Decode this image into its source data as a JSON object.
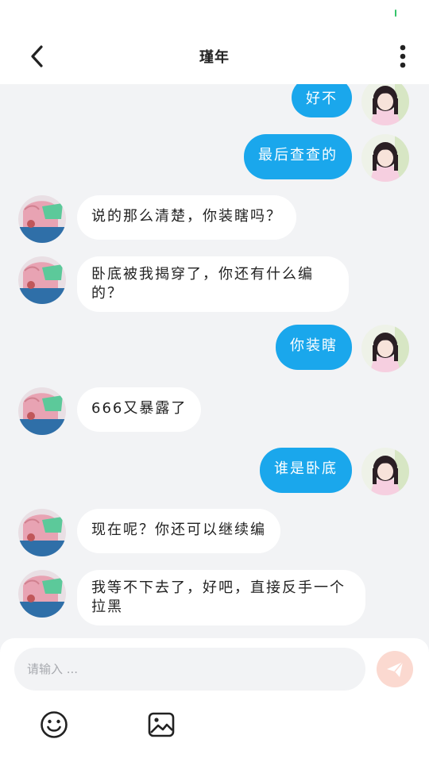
{
  "header": {
    "title": "瑾年"
  },
  "messages": [
    {
      "from": "self",
      "text": "好不"
    },
    {
      "from": "self",
      "text": "最后查查的"
    },
    {
      "from": "other",
      "text": "说的那么清楚，你装瞎吗？"
    },
    {
      "from": "other",
      "text": "卧底被我揭穿了，你还有什么编的？"
    },
    {
      "from": "self",
      "text": "你装瞎"
    },
    {
      "from": "other",
      "text": "666又暴露了"
    },
    {
      "from": "self",
      "text": "谁是卧底"
    },
    {
      "from": "other",
      "text": "现在呢？你还可以继续编"
    },
    {
      "from": "other",
      "text": "我等不下去了，好吧，直接反手一个拉黑"
    }
  ],
  "composer": {
    "placeholder": "请输入 ..."
  },
  "colors": {
    "accent": "#1aa7ec",
    "send_button": "#fbd9d0",
    "background": "#f2f3f5"
  }
}
